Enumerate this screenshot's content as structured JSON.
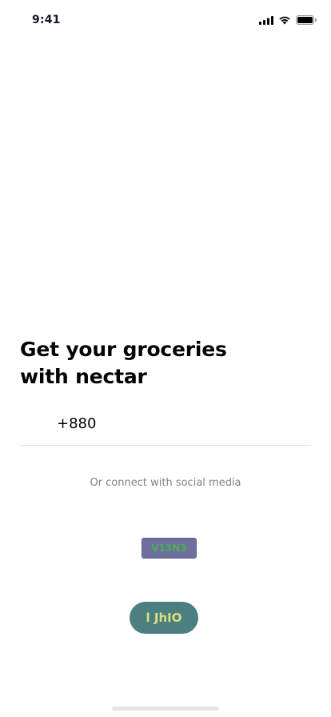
{
  "status_bar": {
    "time": "9:41",
    "icons": [
      "cellular-signal-icon",
      "wifi-icon",
      "battery-icon"
    ]
  },
  "hero": {
    "title": "Get your groceries\nwith nectar"
  },
  "phone_input": {
    "country_code": "+880"
  },
  "social": {
    "caption": "Or connect with social media",
    "google_label": "V13N3",
    "facebook_label": "l JhIO"
  },
  "colors": {
    "text_primary": "#030303",
    "text_muted": "#828282",
    "divider": "#e2e2e2",
    "google_button_bg": "#6e6f9c",
    "google_button_text": "#47b04f",
    "facebook_button_bg": "#4c7f80",
    "facebook_button_text": "#d9e07f"
  }
}
